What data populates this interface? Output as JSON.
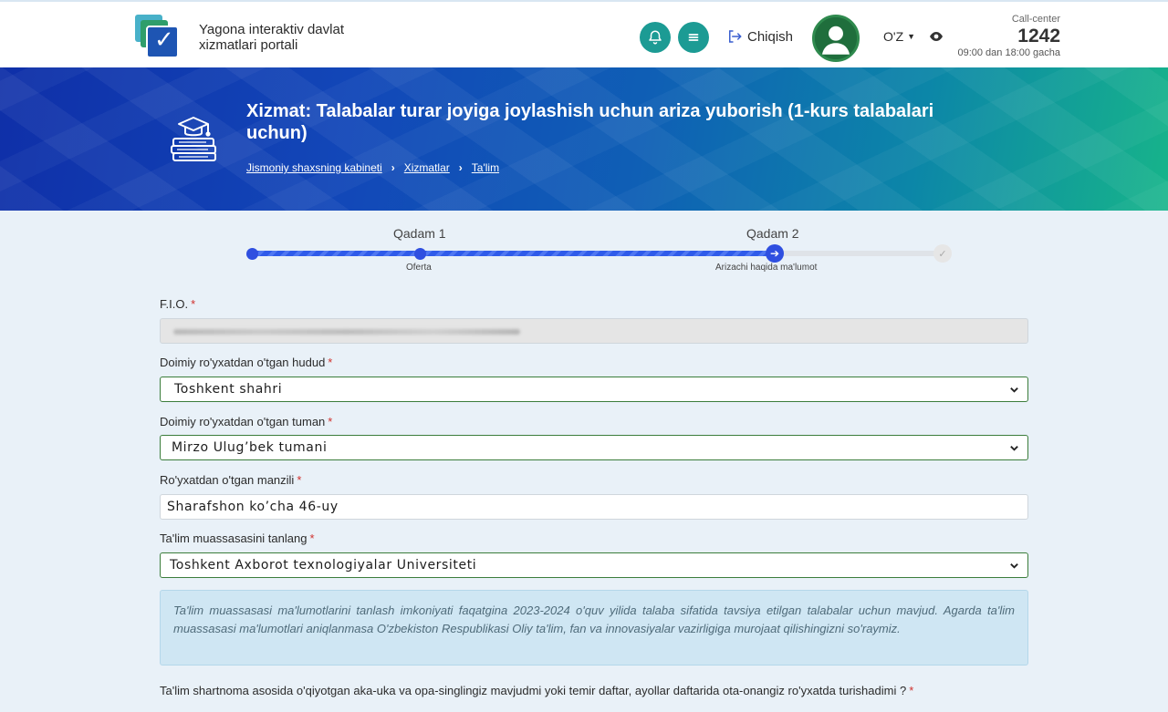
{
  "header": {
    "portal_name": "Yagona interaktiv davlat xizmatlari portali",
    "logout_label": "Chiqish",
    "lang_label": "O'Z",
    "call_center_label": "Call-center",
    "call_center_number": "1242",
    "call_center_hours": "09:00 dan 18:00 gacha",
    "colors": {
      "accent": "#1c9b94",
      "brand_blue": "#1e55b3"
    },
    "icons": [
      "bell-icon",
      "menu-icon",
      "logout-icon",
      "user-icon",
      "eye-icon"
    ]
  },
  "banner": {
    "title": "Xizmat: Talabalar turar joyiga joylashish uchun ariza yuborish (1-kurs talabalari uchun)",
    "breadcrumb": [
      "Jismoniy shaxsning kabineti",
      "Xizmatlar",
      "Ta'lim"
    ],
    "icon": "graduation-books-icon"
  },
  "stepper": {
    "steps": [
      {
        "title": "Qadam 1",
        "sub": "Oferta"
      },
      {
        "title": "Qadam 2",
        "sub": "Arizachi haqida ma'lumot"
      }
    ],
    "colors": {
      "active": "#2f4fe0"
    }
  },
  "form": {
    "fio_label": "F.I.O.",
    "region_label": "Doimiy ro'yxatdan o'tgan hudud",
    "region_value": "Toshkent shahri",
    "district_label": "Doimiy ro'yxatdan o'tgan tuman",
    "district_value": "Mirzo Ulug’bek tumani",
    "address_label": "Ro'yxatdan o'tgan manzili",
    "address_value": "Sharafshon ko’cha 46-uy",
    "institution_label": "Ta'lim muassasasini tanlang",
    "institution_value": "Toshkent Axborot texnologiyalar Universiteti",
    "info_text": "Ta'lim muassasasi ma'lumotlarini tanlash imkoniyati faqatgina 2023-2024 o'quv yilida talaba sifatida tavsiya etilgan talabalar uchun mavjud. Agarda ta'lim muassasasi ma'lumotlari aniqlanmasa O'zbekiston Respublikasi Oliy ta'lim, fan va innovasiyalar vazirligiga murojaat qilishingizni so'raymiz.",
    "question_text": "Ta'lim shartnoma asosida o'qiyotgan aka-uka va opa-singlingiz mavjudmi yoki temir daftar, ayollar daftarida ota-onangiz ro'yxatda turishadimi ?",
    "required_mark": "*"
  }
}
